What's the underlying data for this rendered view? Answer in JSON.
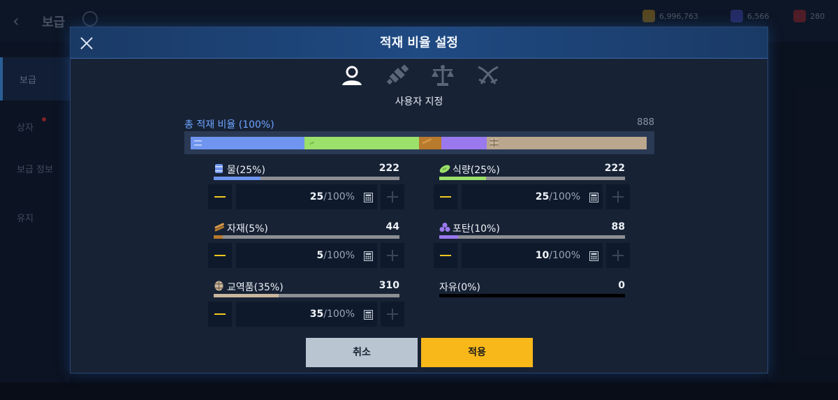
{
  "background": {
    "title": "보급",
    "sidebar": [
      "보급",
      "상자",
      "보급 정보",
      "유지"
    ],
    "resources": [
      "6,996,763",
      "6,566",
      "280"
    ]
  },
  "modal": {
    "title": "적재 비율 설정",
    "mode_tabs": [
      {
        "name": "user-icon",
        "active": true
      },
      {
        "name": "spyglass-icon",
        "active": false
      },
      {
        "name": "scales-icon",
        "active": false
      },
      {
        "name": "crossed-swords-icon",
        "active": false
      }
    ],
    "mode_label": "사용자 지정",
    "total": {
      "label": "총 적재 비율 (100%)",
      "value": "888",
      "segments": [
        {
          "key": "water",
          "percent": 25,
          "color": "#6f95f0"
        },
        {
          "key": "food",
          "percent": 25,
          "color": "#9be06a"
        },
        {
          "key": "material",
          "percent": 5,
          "color": "#b87a2c"
        },
        {
          "key": "ammo",
          "percent": 10,
          "color": "#9a79ee"
        },
        {
          "key": "trade",
          "percent": 35,
          "color": "#bba78e"
        }
      ]
    },
    "resources": [
      {
        "key": "water",
        "icon": "water-barrel-icon",
        "name": "물(25%)",
        "amount": "222",
        "percent": 25,
        "value": "25",
        "suffix": "/100%",
        "color": "#6f95f0"
      },
      {
        "key": "food",
        "icon": "bread-icon",
        "name": "식량(25%)",
        "amount": "222",
        "percent": 25,
        "value": "25",
        "suffix": "/100%",
        "color": "#9be06a"
      },
      {
        "key": "material",
        "icon": "wood-planks-icon",
        "name": "자재(5%)",
        "amount": "44",
        "percent": 5,
        "value": "5",
        "suffix": "/100%",
        "color": "#b87a2c"
      },
      {
        "key": "ammo",
        "icon": "cannonballs-icon",
        "name": "포탄(10%)",
        "amount": "88",
        "percent": 10,
        "value": "10",
        "suffix": "/100%",
        "color": "#9a79ee"
      },
      {
        "key": "trade",
        "icon": "trade-barrel-icon",
        "name": "교역품(35%)",
        "amount": "310",
        "percent": 35,
        "value": "35",
        "suffix": "/100%",
        "color": "#c9b79d"
      },
      {
        "key": "free",
        "icon": "",
        "name": "자유(0%)",
        "amount": "0",
        "percent": 0,
        "color": "#000000"
      }
    ],
    "buttons": {
      "cancel": "취소",
      "apply": "적용"
    }
  }
}
